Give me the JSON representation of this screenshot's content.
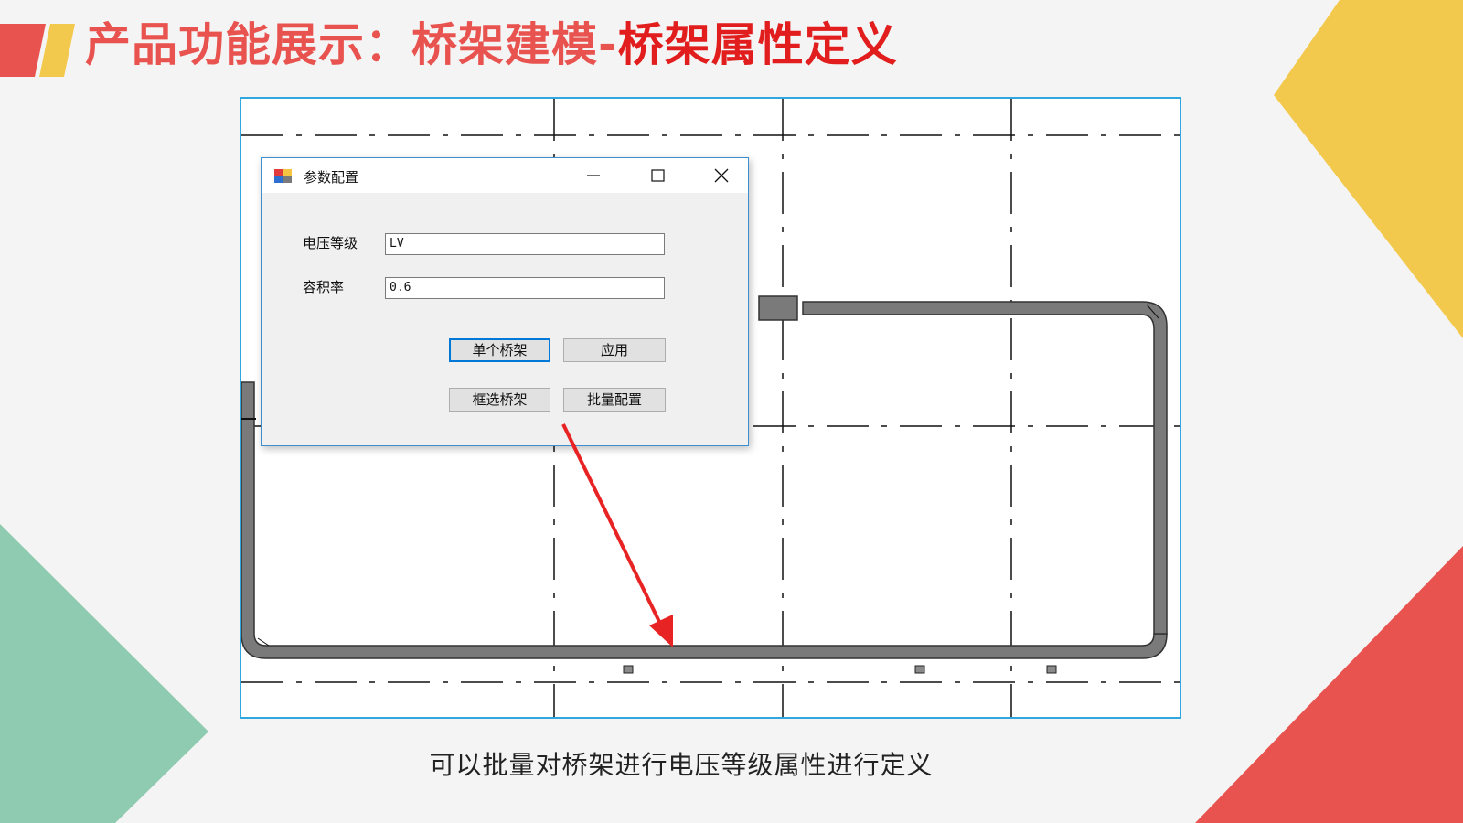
{
  "slide": {
    "title_part1": "产品功能展示：桥架建模-",
    "title_part2": "桥架属性定义",
    "caption": "可以批量对桥架进行电压等级属性进行定义"
  },
  "dialog": {
    "title": "参数配置",
    "window_controls": [
      "minimize-icon",
      "maximize-icon",
      "close-icon"
    ],
    "fields": [
      {
        "label": "电压等级",
        "value": "LV"
      },
      {
        "label": "容积率",
        "value": "0.6"
      }
    ],
    "buttons": {
      "single": "单个桥架",
      "apply": "应用",
      "box_select": "框选桥架",
      "batch": "批量配置"
    }
  },
  "colors": {
    "title_accent": "#e9534f",
    "title_highlight": "#e11d1d",
    "frame_border": "#31a7e0",
    "deco_red": "#e9534f",
    "deco_yellow": "#f2c94c",
    "deco_green": "#8fcbb0",
    "arrow": "#e82323"
  }
}
